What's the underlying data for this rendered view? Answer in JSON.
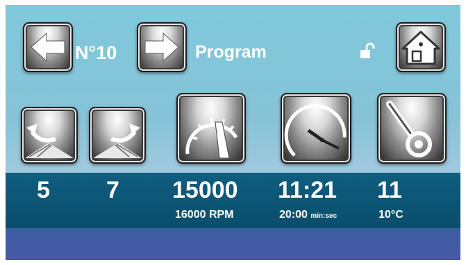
{
  "header": {
    "program_number": "N°10",
    "program_label": "Program"
  },
  "icons": {
    "prev": "arrow-left-icon",
    "next": "arrow-right-icon",
    "lock": "unlocked-padlock-icon",
    "home": "home-icon",
    "accel": "acceleration-ramp-icon",
    "decel": "deceleration-ramp-icon",
    "speed": "speedometer-icon",
    "timer": "clock-icon",
    "temp": "thermometer-icon"
  },
  "readouts": {
    "acceleration": "5",
    "deceleration": "7",
    "speed": {
      "value": "15000",
      "setpoint": "16000 RPM"
    },
    "time": {
      "value": "11:21",
      "setpoint": "20:00",
      "unit": "min:sec"
    },
    "temperature": {
      "value": "11",
      "setpoint": "10°C"
    }
  },
  "colors": {
    "panel_top": "#80c8dc",
    "band": "#0a4d6c",
    "bottom_bar": "#4a57a8",
    "text": "#ffffff"
  }
}
